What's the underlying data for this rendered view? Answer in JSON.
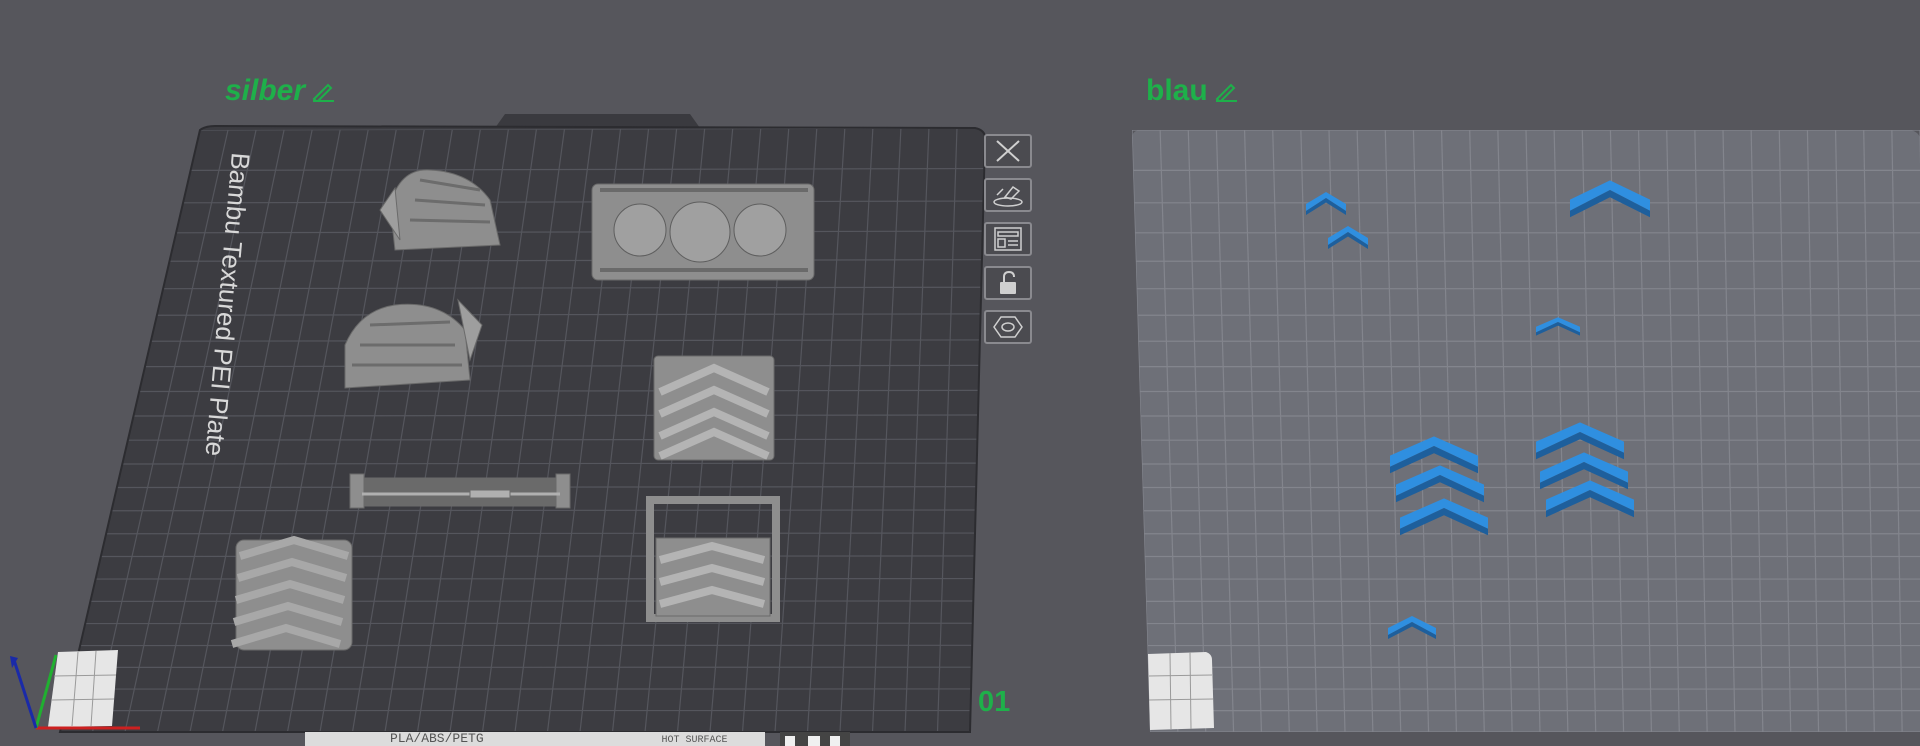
{
  "plates": [
    {
      "name": "silber",
      "bed_label": "Bambu Textured PEI Plate",
      "filament_text": "PLA/ABS/PETG",
      "filament_note": "HOT SURFACE",
      "number": "01"
    },
    {
      "name": "blau"
    }
  ],
  "toolbar": {
    "icons": [
      "close-icon",
      "auto-arrange-icon",
      "layout-icon",
      "unlock-icon",
      "settings-icon"
    ]
  },
  "colors": {
    "background": "#56565c",
    "plate_name": "#1eb04a",
    "bed_dark": "#3d3d42",
    "bed_light": "#6e7078",
    "model_gray": "#8e8e8e",
    "model_blue": "#2f8fe0"
  }
}
